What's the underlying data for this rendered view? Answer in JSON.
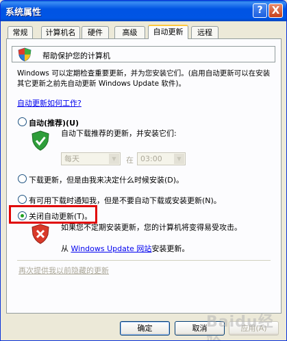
{
  "window": {
    "title": "系统属性",
    "help_glyph": "?",
    "close_glyph": "X"
  },
  "tabs": [
    {
      "label": "常规",
      "active": false
    },
    {
      "label": "计算机名",
      "active": false
    },
    {
      "label": "硬件",
      "active": false
    },
    {
      "label": "高级",
      "active": false
    },
    {
      "label": "自动更新",
      "active": true
    },
    {
      "label": "远程",
      "active": false
    }
  ],
  "header": {
    "text": "帮助保护您的计算机",
    "icon": "security-shield-icon"
  },
  "description": "Windows 可以定期检查重要更新，并为您安装它们。(启用自动更新可以在安装其它更新之前先自动更新 Windows Update 软件)。",
  "how_link": "自动更新如何工作?",
  "options": {
    "auto": {
      "label": "自动(推荐)(U)",
      "sub": "自动下载推荐的更新，并安装它们:",
      "frequency": "每天",
      "at_label": "在",
      "time": "03:00",
      "checked": false
    },
    "download": {
      "label": "下载更新，但是由我来决定什么时候安装(D)。",
      "checked": false
    },
    "notify": {
      "label": "有可用下载时通知我，但是不要自动下载或安装更新(N)。",
      "checked": false
    },
    "off": {
      "label": "关闭自动更新(T)。",
      "checked": true,
      "warning": "如果您不定期安装更新，您的计算机将变得易受攻击。",
      "from_text": "从",
      "from_link": "Windows Update 网站",
      "from_suffix": "安装更新。"
    }
  },
  "hidden_updates_link": "再次提供我以前隐藏的更新",
  "buttons": {
    "ok": "确定",
    "cancel": "取消",
    "apply": "应用(A)"
  },
  "watermark": "Baidu经验",
  "colors": {
    "titlebar": "#0054e3",
    "highlight": "#e00000",
    "link": "#0000ee"
  }
}
